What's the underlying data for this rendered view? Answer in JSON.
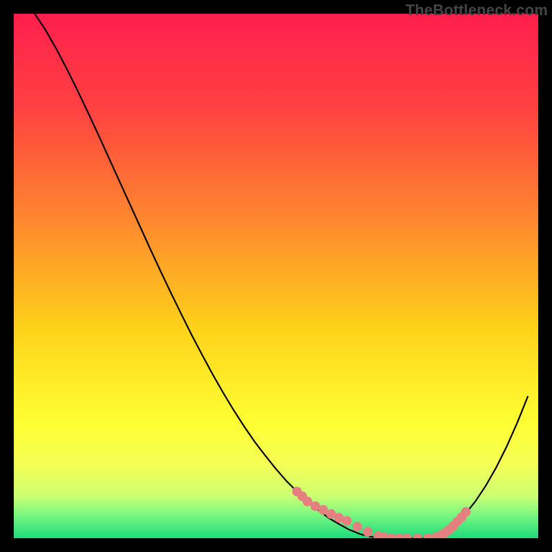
{
  "watermark": "TheBottleneck.com",
  "gradient_stops": [
    {
      "offset": 0.0,
      "color": "#ff1f4d"
    },
    {
      "offset": 0.18,
      "color": "#ff4141"
    },
    {
      "offset": 0.4,
      "color": "#ff8a2e"
    },
    {
      "offset": 0.6,
      "color": "#ffd21a"
    },
    {
      "offset": 0.78,
      "color": "#ffff33"
    },
    {
      "offset": 0.86,
      "color": "#f4ff55"
    },
    {
      "offset": 0.92,
      "color": "#ccff73"
    },
    {
      "offset": 0.955,
      "color": "#7bf780"
    },
    {
      "offset": 1.0,
      "color": "#1edb7c"
    }
  ],
  "chart_data": {
    "type": "line",
    "title": "",
    "xlabel": "",
    "ylabel": "",
    "xlim": [
      0,
      100
    ],
    "ylim": [
      0,
      100
    ],
    "grid": false,
    "legend": null,
    "categories": [
      0,
      2,
      4,
      6,
      8,
      10,
      12,
      14,
      16,
      18,
      20,
      22,
      24,
      26,
      28,
      30,
      32,
      34,
      36,
      38,
      40,
      42,
      44,
      46,
      48,
      50,
      52,
      54,
      56,
      58,
      60,
      62,
      64,
      66,
      68,
      70,
      72,
      74,
      76,
      78,
      80,
      82,
      84,
      86,
      88,
      90,
      92,
      94,
      96,
      98,
      100
    ],
    "values": [
      null,
      null,
      100,
      97,
      93.5,
      89.7,
      85.7,
      81.5,
      77.2,
      72.8,
      68.4,
      64,
      59.6,
      55.2,
      50.9,
      46.7,
      42.6,
      38.6,
      34.8,
      31.1,
      27.6,
      24.3,
      21.2,
      18.3,
      15.7,
      13.2,
      10.9,
      8.9,
      7.0,
      5.4,
      3.9,
      2.7,
      1.6,
      0.8,
      0.3,
      0,
      0,
      0,
      0,
      0,
      0.3,
      1.1,
      2.5,
      4.5,
      7.0,
      10.0,
      13.5,
      17.5,
      22.0,
      27.0,
      null
    ],
    "series": [
      {
        "name": "bottleneck-curve",
        "x": [
          4,
          6,
          8,
          10,
          12,
          14,
          16,
          18,
          20,
          22,
          24,
          26,
          28,
          30,
          32,
          34,
          36,
          38,
          40,
          42,
          44,
          46,
          48,
          50,
          52,
          54,
          56,
          58,
          60,
          62,
          64,
          66,
          68,
          70,
          72,
          74,
          76,
          78,
          80,
          82,
          84,
          86,
          88,
          90,
          92,
          94,
          96,
          98
        ],
        "y": [
          100,
          97,
          93.5,
          89.7,
          85.7,
          81.5,
          77.2,
          72.8,
          68.4,
          64,
          59.6,
          55.2,
          50.9,
          46.7,
          42.6,
          38.6,
          34.8,
          31.1,
          27.6,
          24.3,
          21.2,
          18.3,
          15.7,
          13.2,
          10.9,
          8.9,
          7.0,
          5.4,
          3.9,
          2.7,
          1.6,
          0.8,
          0.3,
          0,
          0,
          0,
          0,
          0,
          0.3,
          1.1,
          2.5,
          4.5,
          7.0,
          10.0,
          13.5,
          17.5,
          22.0,
          27.0
        ]
      },
      {
        "name": "highlight-dots",
        "x": [
          54,
          55,
          56,
          57.5,
          59,
          60.5,
          62,
          63.5,
          65.5,
          67.5,
          69.5,
          70.5,
          72,
          73.5,
          75,
          77,
          79,
          80.5,
          81.5,
          82.2,
          83,
          83.8,
          84.6,
          85.4,
          86.2
        ],
        "y": [
          8.9,
          8.0,
          7.0,
          6.1,
          5.4,
          4.6,
          3.9,
          3.3,
          2.2,
          1.2,
          0.4,
          0.2,
          0,
          0,
          0,
          0,
          0,
          0.2,
          0.6,
          1.0,
          1.6,
          2.3,
          3.2,
          4.0,
          5.0
        ]
      }
    ]
  }
}
